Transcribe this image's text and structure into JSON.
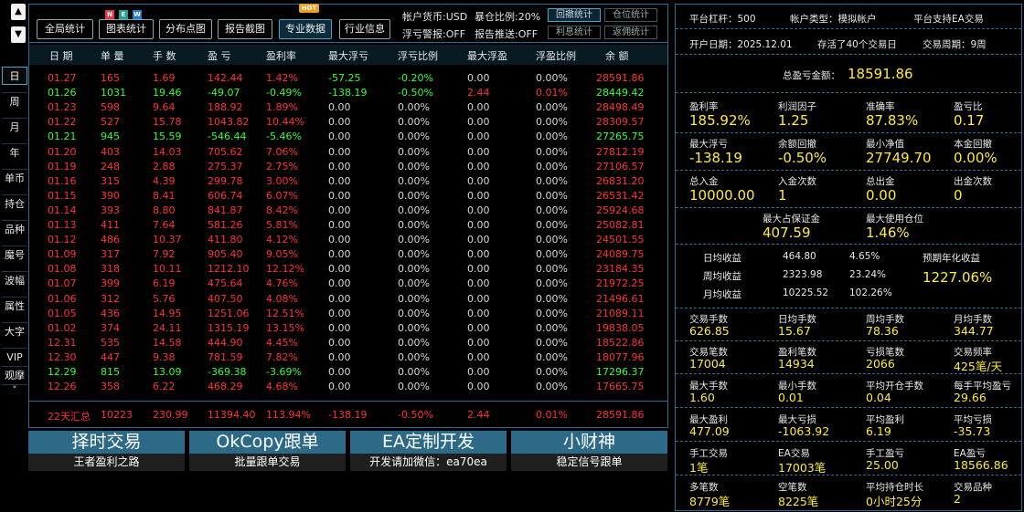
{
  "nav": {
    "up": "▲",
    "down": "▼",
    "more": "˅"
  },
  "side_buttons": [
    "日",
    "周",
    "月",
    "年",
    "单币",
    "持仓",
    "品种",
    "魔号",
    "波幅",
    "属性",
    "大字",
    "VIP",
    "观摩"
  ],
  "toolbar": {
    "buttons": [
      "全局统计",
      "图表统计",
      "分布点图",
      "报告截图",
      "专业数据",
      "行业信息"
    ],
    "badges": {
      "new": [
        "N",
        "E",
        "W"
      ],
      "hot": "HOT"
    },
    "currency": "帐户货币:USD",
    "floating": "暴仓比例:20%",
    "warning": "浮亏警报:OFF",
    "push": "报告推送:OFF",
    "small_buttons": [
      "回撤统计",
      "仓位统计",
      "利息统计",
      "返佣统计"
    ]
  },
  "table": {
    "headers": [
      "日 期",
      "单 量",
      "手 数",
      "盈 亏",
      "盈利率",
      "最大浮亏",
      "浮亏比例",
      "最大浮盈",
      "浮盈比例",
      "余 额"
    ],
    "rows": [
      [
        "01.27",
        "165",
        "1.69",
        "142.44",
        "1.42%",
        "-57.25",
        "-0.20%",
        "0.00",
        "0.00%",
        "28591.86"
      ],
      [
        "01.26",
        "1031",
        "19.46",
        "-49.07",
        "-0.49%",
        "-138.19",
        "-0.50%",
        "2.44",
        "0.01%",
        "28449.42"
      ],
      [
        "01.23",
        "598",
        "9.64",
        "188.92",
        "1.89%",
        "0.00",
        "0.00%",
        "0.00",
        "0.00%",
        "28498.49"
      ],
      [
        "01.22",
        "527",
        "15.78",
        "1043.82",
        "10.44%",
        "0.00",
        "0.00%",
        "0.00",
        "0.00%",
        "28309.57"
      ],
      [
        "01.21",
        "945",
        "15.59",
        "-546.44",
        "-5.46%",
        "0.00",
        "0.00%",
        "0.00",
        "0.00%",
        "27265.75"
      ],
      [
        "01.20",
        "403",
        "14.03",
        "705.62",
        "7.06%",
        "0.00",
        "0.00%",
        "0.00",
        "0.00%",
        "27812.19"
      ],
      [
        "01.19",
        "248",
        "2.88",
        "275.37",
        "2.75%",
        "0.00",
        "0.00%",
        "0.00",
        "0.00%",
        "27106.57"
      ],
      [
        "01.16",
        "315",
        "4.39",
        "299.78",
        "3.00%",
        "0.00",
        "0.00%",
        "0.00",
        "0.00%",
        "26831.20"
      ],
      [
        "01.15",
        "390",
        "8.41",
        "606.74",
        "6.07%",
        "0.00",
        "0.00%",
        "0.00",
        "0.00%",
        "26531.42"
      ],
      [
        "01.14",
        "393",
        "8.80",
        "841.87",
        "8.42%",
        "0.00",
        "0.00%",
        "0.00",
        "0.00%",
        "25924.68"
      ],
      [
        "01.13",
        "411",
        "7.64",
        "581.26",
        "5.81%",
        "0.00",
        "0.00%",
        "0.00",
        "0.00%",
        "25082.81"
      ],
      [
        "01.12",
        "486",
        "10.37",
        "411.80",
        "4.12%",
        "0.00",
        "0.00%",
        "0.00",
        "0.00%",
        "24501.55"
      ],
      [
        "01.09",
        "317",
        "7.92",
        "905.40",
        "9.05%",
        "0.00",
        "0.00%",
        "0.00",
        "0.00%",
        "24089.75"
      ],
      [
        "01.08",
        "318",
        "10.11",
        "1212.10",
        "12.12%",
        "0.00",
        "0.00%",
        "0.00",
        "0.00%",
        "23184.35"
      ],
      [
        "01.07",
        "399",
        "6.19",
        "475.64",
        "4.76%",
        "0.00",
        "0.00%",
        "0.00",
        "0.00%",
        "21972.25"
      ],
      [
        "01.06",
        "312",
        "5.76",
        "407.50",
        "4.08%",
        "0.00",
        "0.00%",
        "0.00",
        "0.00%",
        "21496.61"
      ],
      [
        "01.05",
        "436",
        "14.95",
        "1251.06",
        "12.51%",
        "0.00",
        "0.00%",
        "0.00",
        "0.00%",
        "21089.11"
      ],
      [
        "01.02",
        "374",
        "24.11",
        "1315.19",
        "13.15%",
        "0.00",
        "0.00%",
        "0.00",
        "0.00%",
        "19838.05"
      ],
      [
        "12.31",
        "535",
        "14.58",
        "444.90",
        "4.45%",
        "0.00",
        "0.00%",
        "0.00",
        "0.00%",
        "18522.86"
      ],
      [
        "12.30",
        "447",
        "9.38",
        "781.59",
        "7.82%",
        "0.00",
        "0.00%",
        "0.00",
        "0.00%",
        "18077.96"
      ],
      [
        "12.29",
        "815",
        "13.09",
        "-369.38",
        "-3.69%",
        "0.00",
        "0.00%",
        "0.00",
        "0.00%",
        "17296.37"
      ],
      [
        "12.26",
        "358",
        "6.22",
        "468.29",
        "4.68%",
        "0.00",
        "0.00%",
        "0.00",
        "0.00%",
        "17665.75"
      ]
    ],
    "summary": [
      "22天汇总",
      "10223",
      "230.99",
      "11394.40",
      "113.94%",
      "-138.19",
      "-0.50%",
      "2.44",
      "0.01%",
      "28591.86"
    ]
  },
  "promos": [
    {
      "title": "择时交易",
      "sub": "王者盈利之路"
    },
    {
      "title": "OkCopy跟单",
      "sub": "批量跟单交易"
    },
    {
      "title": "EA定制开发",
      "sub": "开发请加微信：ea70ea"
    },
    {
      "title": "小财神",
      "sub": "稳定信号跟单"
    }
  ],
  "right": {
    "leverage": "平台杠杆：500",
    "acct_type": "帐户类型：模拟帐户",
    "ea": "平台支持EA交易",
    "open_date": "开户日期：2025.12.01",
    "days": "存活了40个交易日",
    "cycle": "交易周期：9周",
    "total_label": "总盈亏金额：",
    "total_value": "18591.86",
    "g1": [
      [
        "盈利率",
        "185.92%"
      ],
      [
        "利润因子",
        "1.25"
      ],
      [
        "准确率",
        "87.83%"
      ],
      [
        "盈亏比",
        "0.17"
      ]
    ],
    "g2": [
      [
        "最大浮亏",
        "-138.19"
      ],
      [
        "余额回撤",
        "-0.50%"
      ],
      [
        "最小净值",
        "27749.70"
      ],
      [
        "本金回撤",
        "0.00%"
      ]
    ],
    "g3": [
      [
        "总入金",
        "10000.00"
      ],
      [
        "入金次数",
        "1"
      ],
      [
        "总出金",
        "0.00"
      ],
      [
        "出金次数",
        "0"
      ]
    ],
    "g4": [
      [
        "最大占保证金",
        "407.59"
      ],
      [
        "最大使用仓位",
        "1.46%"
      ]
    ],
    "earn": [
      [
        "日均收益",
        "464.80",
        "4.65%"
      ],
      [
        "周均收益",
        "2323.98",
        "23.24%"
      ],
      [
        "月均收益",
        "10225.52",
        "102.26%"
      ]
    ],
    "annual_label": "预期年化收益",
    "annual_value": "1227.06%",
    "g5": [
      [
        "交易手数",
        "626.85"
      ],
      [
        "日均手数",
        "15.67"
      ],
      [
        "周均手数",
        "78.36"
      ],
      [
        "月均手数",
        "344.77"
      ]
    ],
    "g6": [
      [
        "交易笔数",
        "17004"
      ],
      [
        "盈利笔数",
        "14934"
      ],
      [
        "亏损笔数",
        "2066"
      ],
      [
        "交易频率",
        "425笔/天"
      ]
    ],
    "g7": [
      [
        "最大手数",
        "1.60"
      ],
      [
        "最小手数",
        "0.01"
      ],
      [
        "平均开仓手数",
        "0.04"
      ],
      [
        "每手平均盈亏",
        "29.66"
      ]
    ],
    "g8": [
      [
        "最大盈利",
        "477.09"
      ],
      [
        "最大亏损",
        "-1063.92"
      ],
      [
        "平均盈利",
        "6.19"
      ],
      [
        "平均亏损",
        "-35.73"
      ]
    ],
    "g9": [
      [
        "手工交易",
        "1笔"
      ],
      [
        "EA交易",
        "17003笔"
      ],
      [
        "手工盈亏",
        "25.00"
      ],
      [
        "EA盈亏",
        "18566.86"
      ]
    ],
    "g10": [
      [
        "多笔数",
        "8779笔"
      ],
      [
        "空笔数",
        "8225笔"
      ],
      [
        "平均持仓时长",
        "0小时25分"
      ],
      [
        "交易品种",
        "2"
      ]
    ]
  },
  "colors": {
    "border": "#2b6e90",
    "profit": "#ff3333",
    "loss": "#33ff33",
    "value": "#ffeb3b"
  }
}
